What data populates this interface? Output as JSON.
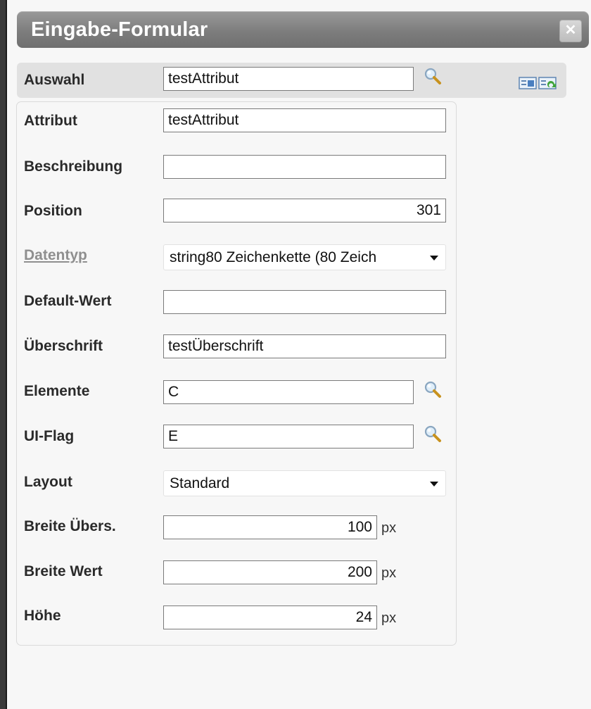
{
  "window": {
    "title": "Eingabe-Formular",
    "close_symbol": "✕"
  },
  "auswahl": {
    "label": "Auswahl",
    "value": "testAttribut",
    "search_icon": "magnifier-icon",
    "action_icons": "copy-form-icons"
  },
  "form": {
    "attribut": {
      "label": "Attribut",
      "value": "testAttribut"
    },
    "beschreibung": {
      "label": "Beschreibung",
      "value": ""
    },
    "position": {
      "label": "Position",
      "value": "301"
    },
    "datentyp": {
      "label": "Datentyp",
      "value": "string80 Zeichenkette (80 Zeich"
    },
    "default_wert": {
      "label": "Default-Wert",
      "value": ""
    },
    "ueberschrift": {
      "label": "Überschrift",
      "value": "testÜberschrift"
    },
    "elemente": {
      "label": "Elemente",
      "value": "C"
    },
    "ui_flag": {
      "label": "UI-Flag",
      "value": "E"
    },
    "layout": {
      "label": "Layout",
      "value": "Standard"
    },
    "breite_uebers": {
      "label": "Breite Übers.",
      "value": "100",
      "unit": "px"
    },
    "breite_wert": {
      "label": "Breite Wert",
      "value": "200",
      "unit": "px"
    },
    "hoehe": {
      "label": "Höhe",
      "value": "24",
      "unit": "px"
    }
  },
  "colors": {
    "titlebar": "#7d7d7d",
    "disabled_label": "#8f8f8f",
    "background": "#f7f7f7"
  }
}
